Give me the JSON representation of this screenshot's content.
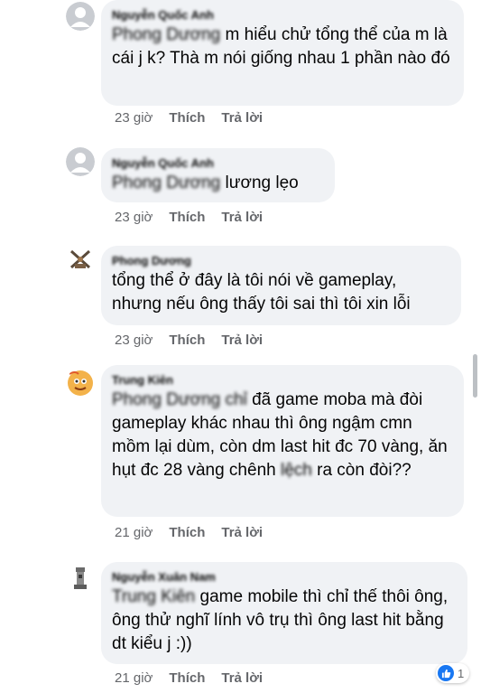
{
  "comments": [
    {
      "author": "Nguyễn Quốc Anh",
      "mention": "Phong Dương",
      "text": "m hiểu chử tổng thể của m là cái j k? Thà m nói giống nhau 1 phần nào đó",
      "time": "23 giờ",
      "like_label": "Thích",
      "reply_label": "Trả lời",
      "avatar_icon": "default-avatar-icon"
    },
    {
      "author": "Nguyễn Quốc Anh",
      "mention": "Phong Dương",
      "text": "lương lẹo",
      "time": "23 giờ",
      "like_label": "Thích",
      "reply_label": "Trả lời",
      "avatar_icon": "default-avatar-icon"
    },
    {
      "author": "Phong Dương",
      "mention": "",
      "text": "tổng thể ở đây là tôi nói về gameplay, nhưng nếu ông thấy tôi sai thì tôi xin lỗi",
      "time": "23 giờ",
      "like_label": "Thích",
      "reply_label": "Trả lời",
      "avatar_icon": "crossed-swords-avatar-icon"
    },
    {
      "author": "Trung Kiên",
      "mention": "Phong Dương chỉ",
      "text_before": "đã game moba mà đòi gameplay khác nhau thì ông ngậm cmn mồm lại dùm, còn dm last hit đc 70 vàng, ăn hụt đc 28 vàng chênh",
      "redacted": "lệch",
      "text_after": "ra còn đòi??",
      "time": "21 giờ",
      "like_label": "Thích",
      "reply_label": "Trả lời",
      "avatar_icon": "cartoon-face-avatar-icon"
    },
    {
      "author": "Nguyễn Xuân Nam",
      "mention": "Trung Kiên",
      "text": "game mobile thì chỉ thế thôi ông, ông thử nghĩ lính vô trụ thì ông last hit bằng dt kiểu j :))",
      "time": "21 giờ",
      "like_label": "Thích",
      "reply_label": "Trả lời",
      "avatar_icon": "tower-avatar-icon",
      "reaction_count": "1",
      "reaction_icon": "like-reaction-icon"
    }
  ],
  "colors": {
    "bubble": "#f0f2f5",
    "meta": "#65676b",
    "like_blue": "#1877f2"
  }
}
